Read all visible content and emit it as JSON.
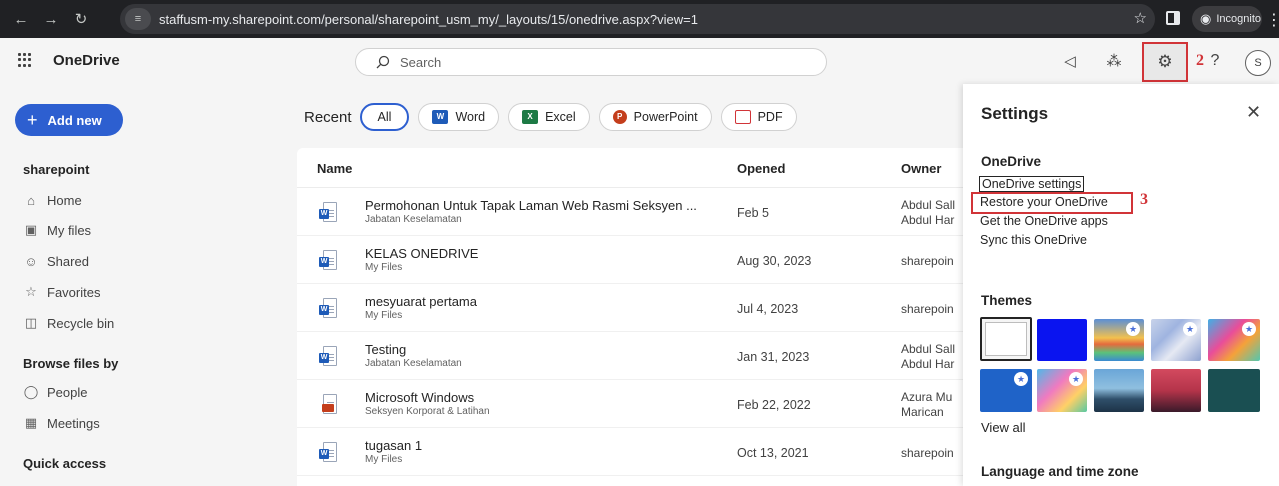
{
  "browser": {
    "url": "staffusm-my.sharepoint.com/personal/sharepoint_usm_my/_layouts/15/onedrive.aspx?view=1",
    "incognito_label": "Incognito"
  },
  "app": {
    "title": "OneDrive",
    "search_placeholder": "Search",
    "avatar_initial": "S",
    "annotation_2": "2",
    "annotation_3": "3",
    "accent_color": "#2d5fd0",
    "highlight_color": "#d13438"
  },
  "sidebar": {
    "add_new": "Add new",
    "section_title": "sharepoint",
    "items": [
      {
        "label": "Home",
        "icon": "home-icon"
      },
      {
        "label": "My files",
        "icon": "folder-icon"
      },
      {
        "label": "Shared",
        "icon": "people-icon"
      },
      {
        "label": "Favorites",
        "icon": "star-icon"
      },
      {
        "label": "Recycle bin",
        "icon": "recycle-bin-icon"
      }
    ],
    "browse_heading": "Browse files by",
    "browse_items": [
      {
        "label": "People",
        "icon": "person-icon"
      },
      {
        "label": "Meetings",
        "icon": "calendar-icon"
      }
    ],
    "quick_access_heading": "Quick access"
  },
  "main": {
    "recent_label": "Recent",
    "filters": [
      "All",
      "Word",
      "Excel",
      "PowerPoint",
      "PDF"
    ],
    "columns": {
      "name": "Name",
      "opened": "Opened",
      "owner": "Owner"
    },
    "files": [
      {
        "name": "Permohonan Untuk Tapak Laman Web Rasmi Seksyen ...",
        "location": "Jabatan Keselamatan",
        "opened": "Feb 5",
        "owner": [
          "Abdul Sall",
          "Abdul Har"
        ],
        "type": "word"
      },
      {
        "name": "KELAS ONEDRIVE",
        "location": "My Files",
        "opened": "Aug 30, 2023",
        "owner": [
          "sharepoin"
        ],
        "type": "word"
      },
      {
        "name": "mesyuarat pertama",
        "location": "My Files",
        "opened": "Jul 4, 2023",
        "owner": [
          "sharepoin"
        ],
        "type": "word"
      },
      {
        "name": "Testing",
        "location": "Jabatan Keselamatan",
        "opened": "Jan 31, 2023",
        "owner": [
          "Abdul Sall",
          "Abdul Har"
        ],
        "type": "word"
      },
      {
        "name": "Microsoft Windows",
        "location": "Seksyen Korporat & Latihan",
        "opened": "Feb 22, 2022",
        "owner": [
          "Azura Mu",
          "Marican"
        ],
        "type": "powerpoint"
      },
      {
        "name": "tugasan 1",
        "location": "My Files",
        "opened": "Oct 13, 2021",
        "owner": [
          "sharepoin"
        ],
        "type": "word"
      }
    ]
  },
  "settings": {
    "title": "Settings",
    "onedrive_heading": "OneDrive",
    "links": [
      "OneDrive settings",
      "Restore your OneDrive",
      "Get the OneDrive apps",
      "Sync this OneDrive"
    ],
    "themes_heading": "Themes",
    "view_all": "View all",
    "language_heading": "Language and time zone"
  }
}
